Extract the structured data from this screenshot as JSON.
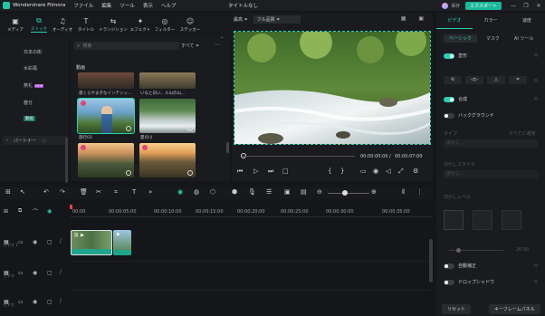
{
  "titlebar": {
    "app_name": "Wondershare Filmora",
    "menu": [
      "ファイル",
      "編集",
      "ツール",
      "表示",
      "ヘルプ"
    ],
    "document_title": "タイトルなし",
    "account_label": "保存",
    "export_label": "エクスポート",
    "window_controls": [
      "—",
      "❐",
      "✕"
    ]
  },
  "media_tabs": [
    {
      "label": "メディア",
      "icon": "media-icon",
      "glyph": "▣"
    },
    {
      "label": "ストック",
      "icon": "stock-icon",
      "glyph": "⧉",
      "active": true
    },
    {
      "label": "オーディオ",
      "icon": "audio-icon",
      "glyph": "♫"
    },
    {
      "label": "タイトル",
      "icon": "title-icon",
      "glyph": "T"
    },
    {
      "label": "トランジション",
      "icon": "transition-icon",
      "glyph": "⇆"
    },
    {
      "label": "エフェクト",
      "icon": "effect-icon",
      "glyph": "✦"
    },
    {
      "label": "フィルター",
      "icon": "filter-icon",
      "glyph": "◎"
    },
    {
      "label": "ステッカー",
      "icon": "sticker-icon",
      "glyph": "☺"
    }
  ],
  "categories": {
    "items": [
      "日本の街",
      "水彩風",
      "祭礼",
      "春分",
      "動画"
    ],
    "new_badge": "NEW",
    "partner": "パートナー"
  },
  "browser": {
    "search_placeholder": "検索",
    "filter_label": "すべて",
    "section_label": "動画",
    "thumbs": [
      {
        "caption": "夜くらやま子なインテンッ..."
      },
      {
        "caption": "いなと白い、ル山の山..."
      },
      {
        "caption": "旅行03"
      },
      {
        "caption": "夏の川"
      },
      {
        "caption": ""
      },
      {
        "caption": ""
      }
    ]
  },
  "preview": {
    "quality_label": "最高",
    "fit_label": "フル品質",
    "current_time": "00:00:00:00",
    "separator": "/",
    "total_time": "00:00:07:00"
  },
  "properties": {
    "tabs": [
      "ビデオ",
      "カラー",
      "速度"
    ],
    "subtabs": [
      "ベーシック",
      "マスク",
      "AI ツール"
    ],
    "transform_label": "変形",
    "composite_label": "合成",
    "background_label": "バックグラウンド",
    "type_label": "タイプ",
    "type_value": "ぼかし",
    "apply_all": "すべてに適用",
    "blur_style_label": "ぼかしスタイル",
    "blur_style_value": "ぼかし",
    "blur_level_label": "ぼかしレベル",
    "blur_percent": "20.00",
    "auto_enhance_label": "自動補正",
    "drop_shadow_label": "ドロップシャドウ",
    "reset_label": "リセット",
    "keyframe_label": "キーフレームパネル"
  },
  "ruler": {
    "labels": [
      "00:00",
      "00:00:05:00",
      "00:00:10:00",
      "00:00:15:00",
      "00:00:20:00",
      "00:00:25:00",
      "00:00:30:00",
      "00:00:35:00"
    ]
  },
  "tracks": [
    {
      "name": "ビデオ 1"
    },
    {
      "name": "ビデオ"
    },
    {
      "name": "ビデオ"
    }
  ],
  "clips": [
    {
      "label": "旅"
    },
    {
      "label": ""
    }
  ],
  "colors": {
    "accent": "#27d3b2",
    "export": "#18b89a",
    "clip": "#1fa58c",
    "playhead": "#ee4444"
  }
}
